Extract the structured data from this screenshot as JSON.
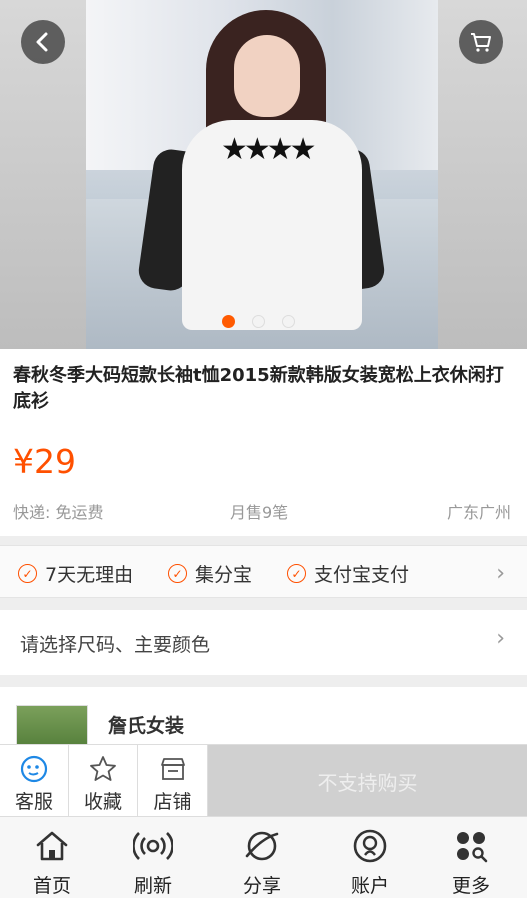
{
  "hero": {
    "back_icon": "chevron-left-icon",
    "cart_icon": "cart-icon",
    "active_slide": 1,
    "slide_count": 3
  },
  "product": {
    "title": "春秋冬季大码短款长袖t恤2015新款韩版女装宽松上衣休闲打底衫",
    "price": "¥29",
    "shipping": "快递: 免运费",
    "monthly_sales": "月售9笔",
    "location": "广东广州"
  },
  "services": {
    "items": [
      "7天无理由",
      "集分宝",
      "支付宝支付"
    ],
    "check_icon": "check-circle-icon",
    "more_icon": "chevron-right-icon"
  },
  "select_option": {
    "label": "请选择尺码、主要颜色"
  },
  "shop": {
    "name": "詹氏女装"
  },
  "actions": {
    "service_label": "客服",
    "favorite_label": "收藏",
    "store_label": "店铺",
    "buy_label": "不支持购买"
  },
  "nav": {
    "home": "首页",
    "refresh": "刷新",
    "share": "分享",
    "account": "账户",
    "more": "更多"
  },
  "colors": {
    "accent": "#ff5000",
    "service_icon": "#1e88e5",
    "disabled_buy": "#d0d0d0"
  }
}
